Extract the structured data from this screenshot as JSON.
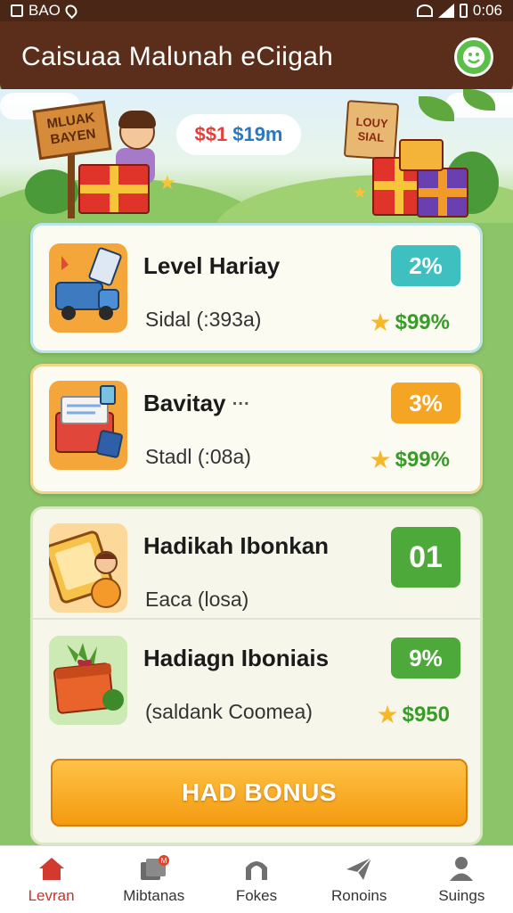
{
  "status_bar": {
    "left_text": "BAO",
    "time": "0:06"
  },
  "app_bar": {
    "title": "Caisuaa Malυnah eCiigah"
  },
  "banner": {
    "sign_text": "MLUAK BAYEN",
    "bubble_price_1": "$$1",
    "bubble_price_2": "$19m",
    "bag_text": "LOUY SIAL"
  },
  "cards": [
    {
      "title": "Level Hariay",
      "subtitle": "Sidal (:393a)",
      "badge": "2%",
      "badge_color": "#3ec0c0",
      "reward": "$99%"
    },
    {
      "title": "Bavitay",
      "title_suffix": "···",
      "subtitle": "Stadl (:08a)",
      "badge": "3%",
      "badge_color": "#f5a524",
      "reward": "$99%"
    },
    {
      "title": "Hadikah Ibonkan",
      "subtitle": "Eaca (losa)",
      "badge": "01",
      "badge_color": "#4ea93b"
    },
    {
      "title": "Hadiagn Iboniais",
      "subtitle": "(saldank Coomea)",
      "badge": "9%",
      "badge_color": "#4ea93b",
      "reward": "$950"
    }
  ],
  "bonus_button": {
    "label": "HAD BONUS"
  },
  "bottom_nav": [
    {
      "label": "Levran",
      "icon": "home-icon",
      "active": true
    },
    {
      "label": "Mibtanas",
      "icon": "cards-icon",
      "badge": "M",
      "active": false
    },
    {
      "label": "Fokes",
      "icon": "arch-icon",
      "active": false
    },
    {
      "label": "Ronoins",
      "icon": "send-icon",
      "active": false
    },
    {
      "label": "Suings",
      "icon": "person-icon",
      "active": false
    }
  ],
  "colors": {
    "app_bar": "#5a2e1a",
    "accent_orange": "#f5a524",
    "accent_teal": "#3ec0c0",
    "accent_green": "#4ea93b",
    "nav_active": "#c5342b"
  }
}
